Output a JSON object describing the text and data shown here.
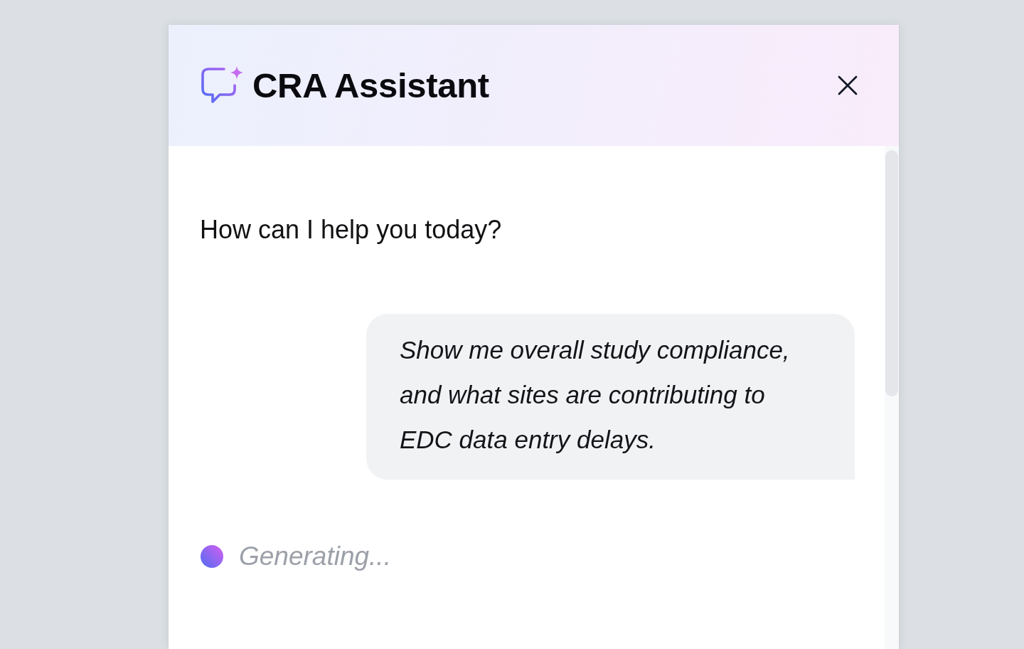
{
  "header": {
    "title": "CRA Assistant"
  },
  "messages": [
    {
      "kind": "assistant",
      "text": "How can I help you today?"
    },
    {
      "kind": "user",
      "text": "Show me overall study compliance, and what sites are contributing to EDC data entry delays."
    }
  ],
  "status": {
    "text": "Generating..."
  }
}
